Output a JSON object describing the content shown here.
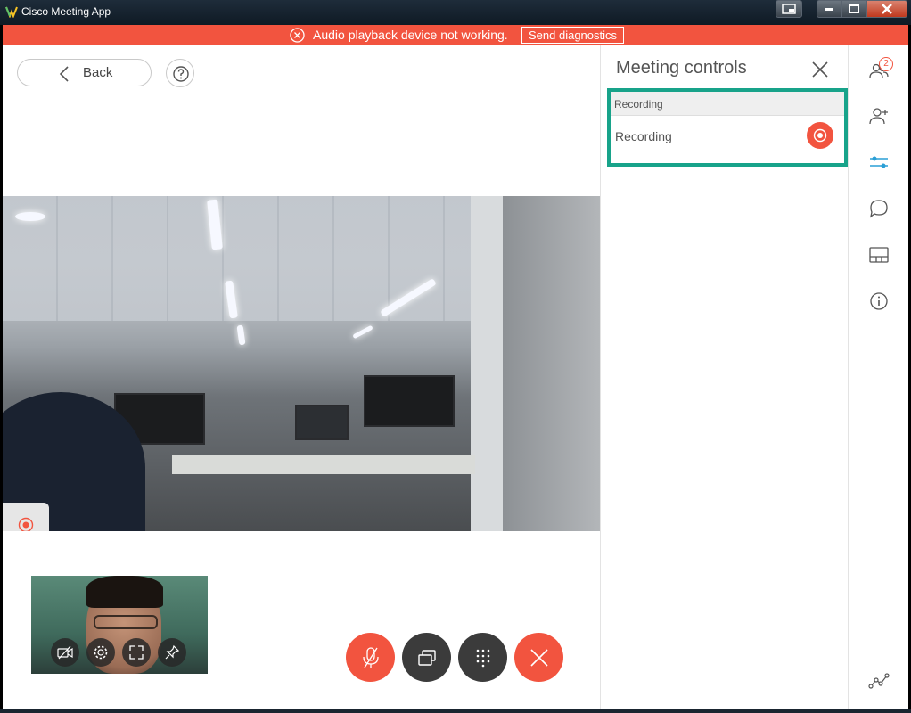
{
  "window": {
    "title": "Cisco Meeting App"
  },
  "alert": {
    "message": "Audio playback device not working.",
    "action_label": "Send diagnostics"
  },
  "nav": {
    "back_label": "Back"
  },
  "panel": {
    "title": "Meeting controls",
    "section_header": "Recording",
    "recording_label": "Recording"
  },
  "rail": {
    "participants_count": "2",
    "items": [
      "participants-icon",
      "add-participant-icon",
      "meeting-controls-icon",
      "chat-icon",
      "layout-icon",
      "info-icon",
      "network-stats-icon"
    ]
  },
  "colors": {
    "accent_red": "#f2543f",
    "highlight_teal": "#18a38a",
    "rail_active": "#2a9fd6",
    "dark_button": "#3b3b3b"
  }
}
